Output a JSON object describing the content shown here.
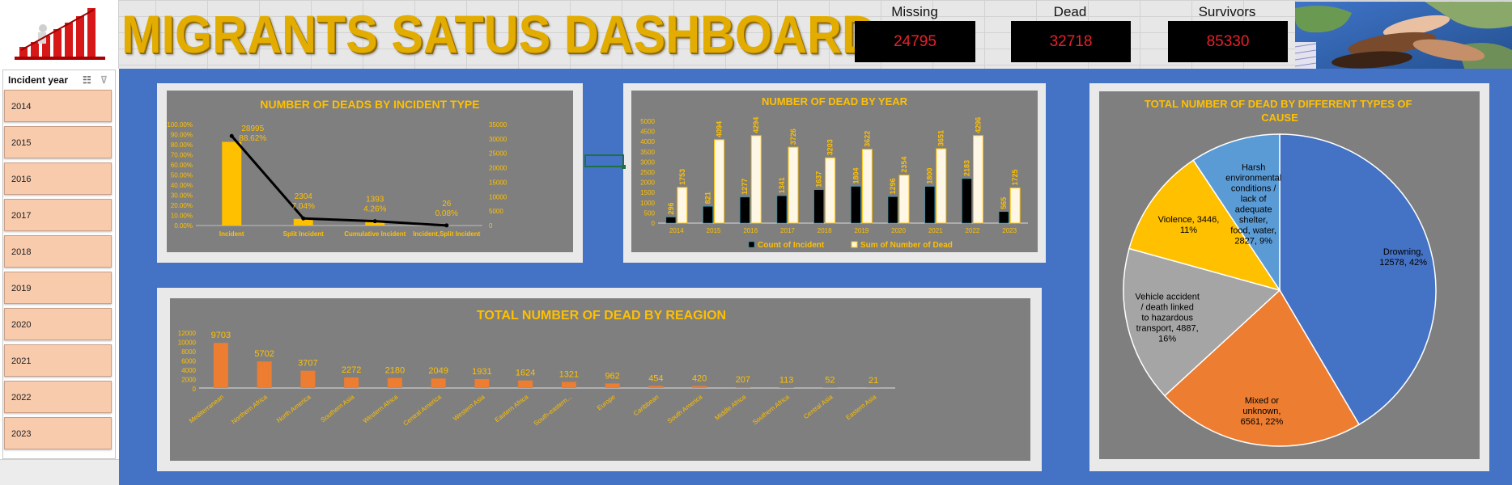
{
  "dashboard": {
    "title": "MIGRANTS SATUS DASHBOARD",
    "kpis": [
      {
        "label": "Missing",
        "value": "24795"
      },
      {
        "label": "Dead",
        "value": "32718"
      },
      {
        "label": "Survivors",
        "value": "85330"
      }
    ]
  },
  "slicer": {
    "title": "Incident year",
    "years": [
      "2014",
      "2015",
      "2016",
      "2017",
      "2018",
      "2019",
      "2020",
      "2021",
      "2022",
      "2023"
    ]
  },
  "colors": {
    "title_gold": "#e2ac00",
    "chart_gold": "#ffc000",
    "canvas_blue": "#4472c4",
    "plot_gray": "#7f7f7f",
    "kpi_red": "#e8202a",
    "bar_orange": "#ed7d31",
    "slicer_peach": "#f8cbad"
  },
  "chart_data": [
    {
      "type": "bar",
      "title": "NUMBER OF DEADS BY INCIDENT TYPE",
      "categories": [
        "Incident",
        "Split Incident",
        "Cumulative Incident",
        "Incident,Split Incident"
      ],
      "series": [
        {
          "values": [
            28995,
            2304,
            1393,
            26
          ]
        },
        {
          "values": [
            88.62,
            7.04,
            4.26,
            0.08
          ]
        }
      ],
      "value_labels": [
        "28995",
        "2304",
        "1393",
        "26"
      ],
      "pct_labels": [
        "88.62%",
        "7.04%",
        "4.26%",
        "0.08%"
      ],
      "left_axis_ticks": [
        "0.00%",
        "10.00%",
        "20.00%",
        "30.00%",
        "40.00%",
        "50.00%",
        "60.00%",
        "70.00%",
        "80.00%",
        "90.00%",
        "100.00%"
      ],
      "right_axis_ticks": [
        "0",
        "5000",
        "10000",
        "15000",
        "20000",
        "25000",
        "30000",
        "35000"
      ],
      "ylim": [
        0,
        35000
      ],
      "y2lim": [
        0,
        100
      ]
    },
    {
      "type": "bar",
      "title": "NUMBER OF DEAD BY YEAR",
      "categories": [
        "2014",
        "2015",
        "2016",
        "2017",
        "2018",
        "2019",
        "2020",
        "2021",
        "2022",
        "2023"
      ],
      "series": [
        {
          "name": "Count of Incident",
          "values": [
            296,
            821,
            1277,
            1341,
            1637,
            1804,
            1296,
            1800,
            2183,
            565
          ]
        },
        {
          "name": "Sum of Number of Dead",
          "values": [
            1753,
            4094,
            4294,
            3726,
            3203,
            3622,
            2354,
            3651,
            4296,
            1725
          ]
        }
      ],
      "y_ticks": [
        "0",
        "500",
        "1000",
        "1500",
        "2000",
        "2500",
        "3000",
        "3500",
        "4000",
        "4500",
        "5000"
      ],
      "ylim": [
        0,
        5000
      ],
      "legend": "bottom"
    },
    {
      "type": "pie",
      "title": "TOTAL NUMBER OF DEAD BY DIFFERENT TYPES OF CAUSE",
      "slices": [
        {
          "label": "Drowning",
          "value": 12578,
          "pct": "42%",
          "text": "Drowning, 12578, 42%",
          "color": "#4472c4"
        },
        {
          "label": "Mixed or unknown",
          "value": 6561,
          "pct": "22%",
          "text": "Mixed or unknown, 6561, 22%",
          "color": "#ed7d31"
        },
        {
          "label": "Vehicle accident / death linked to hazardous transport",
          "value": 4887,
          "pct": "16%",
          "text": "Vehicle accident / death linked to hazardous transport, 4887, 16%",
          "color": "#a5a5a5"
        },
        {
          "label": "Violence",
          "value": 3446,
          "pct": "11%",
          "text": "Violence, 3446, 11%",
          "color": "#ffc000"
        },
        {
          "label": "Harsh environmental conditions / lack of adequate shelter, food, water",
          "value": 2827,
          "pct": "9%",
          "text": "Harsh environmental conditions / lack of adequate shelter, food, water, 2827, 9%",
          "color": "#5b9bd5"
        }
      ]
    },
    {
      "type": "bar",
      "title": "TOTAL NUMBER OF DEAD BY REAGION",
      "categories": [
        "Mediterranean",
        "Northern Africa",
        "North America",
        "Southern Asia",
        "Western Africa",
        "Central America",
        "Western Asia",
        "Eastern Africa",
        "South-eastern...",
        "Europe",
        "Caribbean",
        "South America",
        "Middle Africa",
        "Southern Africa",
        "Central Asia",
        "Eastern Asia"
      ],
      "values": [
        9703,
        5702,
        3707,
        2272,
        2180,
        2049,
        1931,
        1624,
        1321,
        962,
        454,
        420,
        207,
        113,
        52,
        21
      ],
      "y_ticks": [
        "0",
        "2000",
        "4000",
        "6000",
        "8000",
        "10000",
        "12000"
      ],
      "ylim": [
        0,
        12000
      ]
    }
  ]
}
